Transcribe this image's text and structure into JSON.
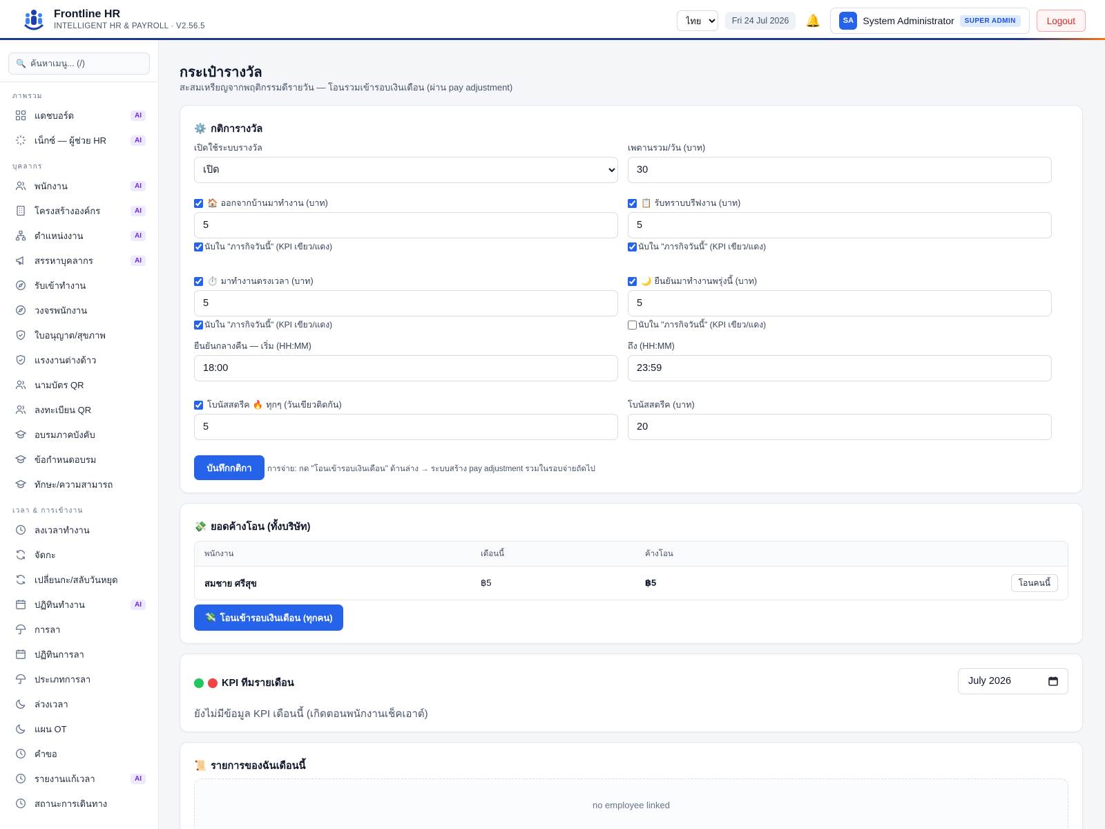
{
  "app": {
    "name": "Frontline HR",
    "subtitle": "INTELLIGENT HR & PAYROLL · V2.56.5"
  },
  "topbar": {
    "language": "ไทย",
    "date": "Fri 24 Jul 2026",
    "user_initials": "SA",
    "user_name": "System Administrator",
    "user_role": "SUPER ADMIN",
    "logout_label": "Logout"
  },
  "sidebar": {
    "search_placeholder": "ค้นหาเมนู... (/)",
    "sections": [
      {
        "title": "ภาพรวม",
        "items": [
          {
            "label": "แดชบอร์ด",
            "icon": "grid-icon",
            "ai": true
          },
          {
            "label": "เน็กซ์ — ผู้ช่วย HR",
            "icon": "sparkle-icon",
            "ai": true
          }
        ]
      },
      {
        "title": "บุคลากร",
        "items": [
          {
            "label": "พนักงาน",
            "icon": "users-icon",
            "ai": true
          },
          {
            "label": "โครงสร้างองค์กร",
            "icon": "building-icon",
            "ai": true
          },
          {
            "label": "ตำแหน่งงาน",
            "icon": "org-chart-icon",
            "ai": true
          },
          {
            "label": "สรรหาบุคลากร",
            "icon": "megaphone-icon",
            "ai": true
          },
          {
            "label": "รับเข้าทำงาน",
            "icon": "compass-icon",
            "ai": false
          },
          {
            "label": "วงจรพนักงาน",
            "icon": "compass-icon",
            "ai": false
          },
          {
            "label": "ใบอนุญาต/สุขภาพ",
            "icon": "shield-icon",
            "ai": false
          },
          {
            "label": "แรงงานต่างด้าว",
            "icon": "shield-icon",
            "ai": false
          },
          {
            "label": "นามบัตร QR",
            "icon": "users-icon",
            "ai": false
          },
          {
            "label": "ลงทะเบียน QR",
            "icon": "users-icon",
            "ai": false
          },
          {
            "label": "อบรมภาคบังคับ",
            "icon": "graduation-cap-icon",
            "ai": false
          },
          {
            "label": "ข้อกำหนดอบรม",
            "icon": "graduation-cap-icon",
            "ai": false
          },
          {
            "label": "ทักษะ/ความสามารถ",
            "icon": "graduation-cap-icon",
            "ai": false
          }
        ]
      },
      {
        "title": "เวลา & การเข้างาน",
        "items": [
          {
            "label": "ลงเวลาทำงาน",
            "icon": "clock-icon",
            "ai": false
          },
          {
            "label": "จัดกะ",
            "icon": "refresh-icon",
            "ai": false
          },
          {
            "label": "เปลี่ยนกะ/สลับวันหยุด",
            "icon": "refresh-icon",
            "ai": false
          },
          {
            "label": "ปฏิทินทำงาน",
            "icon": "calendar-icon",
            "ai": true
          },
          {
            "label": "การลา",
            "icon": "umbrella-icon",
            "ai": false
          },
          {
            "label": "ปฏิทินการลา",
            "icon": "calendar-icon",
            "ai": false
          },
          {
            "label": "ประเภทการลา",
            "icon": "umbrella-icon",
            "ai": false
          },
          {
            "label": "ล่วงเวลา",
            "icon": "moon-icon",
            "ai": false
          },
          {
            "label": "แผน OT",
            "icon": "moon-icon",
            "ai": false
          },
          {
            "label": "คำขอ",
            "icon": "clock-icon",
            "ai": false
          },
          {
            "label": "รายงานแก้เวลา",
            "icon": "clock-icon",
            "ai": true
          },
          {
            "label": "สถานะการเดินทาง",
            "icon": "clock-icon",
            "ai": false
          }
        ]
      }
    ],
    "ai_label": "AI"
  },
  "page": {
    "title": "กระเป๋ารางวัล",
    "subtitle": "สะสมเหรียญจากพฤติกรรมดีรายวัน — โอนรวมเข้ารอบเงินเดือน (ผ่าน pay adjustment)"
  },
  "rules": {
    "title": "กติการางวัล",
    "title_icon": "⚙️",
    "enable_label": "เปิดใช้ระบบรางวัล",
    "enable_value": "เปิด",
    "daily_cap_label": "เพดานรวม/วัน (บาท)",
    "daily_cap_value": "30",
    "count_label": "นับใน \"ภารกิจวันนี้\" (KPI เขียว/แดง)",
    "leave_home": {
      "icon": "🏠",
      "label": "ออกจากบ้านมาทำงาน (บาท)",
      "value": "5",
      "enabled": true,
      "count": true
    },
    "briefing": {
      "icon": "📋",
      "label": "รับทราบบรีฟงาน (บาท)",
      "value": "5",
      "enabled": true,
      "count": true
    },
    "on_time": {
      "icon": "⏱️",
      "label": "มาทำงานตรงเวลา (บาท)",
      "value": "5",
      "enabled": true,
      "count": true
    },
    "confirm_tomorrow": {
      "icon": "🌙",
      "label": "ยืนยันมาทำงานพรุ่งนี้ (บาท)",
      "value": "5",
      "enabled": true,
      "count": false
    },
    "night_start_label": "ยืนยันกลางคืน — เริ่ม (HH:MM)",
    "night_start_value": "18:00",
    "night_end_label": "ถึง (HH:MM)",
    "night_end_value": "23:59",
    "streak_every_label_a": "โบนัสสตรีค",
    "streak_every_icon": "🔥",
    "streak_every_label_b": "ทุกๆ (วันเขียวติดกัน)",
    "streak_every_value": "5",
    "streak_bonus_label": "โบนัสสตรีค (บาท)",
    "streak_bonus_value": "20",
    "save_label": "บันทึกกติกา",
    "save_hint": "การจ่าย: กด \"โอนเข้ารอบเงินเดือน\" ด้านล่าง → ระบบสร้าง pay adjustment รวมในรอบจ่ายถัดไป"
  },
  "pending": {
    "title": "ยอดค้างโอน (ทั้งบริษัท)",
    "title_icon": "💸",
    "columns": [
      "พนักงาน",
      "เดือนนี้",
      "ค้างโอน"
    ],
    "rows": [
      {
        "employee": "สมชาย ศรีสุข",
        "this_month": "฿5",
        "pending": "฿5",
        "action": "โอนคนนี้"
      }
    ],
    "transfer_all_icon": "💸",
    "transfer_all_label": "โอนเข้ารอบเงินเดือน (ทุกคน)"
  },
  "kpi": {
    "title": "KPI ทีมรายเดือน",
    "month": "July 2026",
    "empty": "ยังไม่มีข้อมูล KPI เดือนนี้ (เกิดตอนพนักงานเช็คเอาต์)",
    "green": "#22c55e",
    "red": "#ef4444"
  },
  "my_items": {
    "title": "รายการของฉันเดือนนี้",
    "title_icon": "📜",
    "empty": "no employee linked"
  },
  "colors": {
    "primary": "#2563eb",
    "brand_navy": "#1e3a8a",
    "accent_orange": "#f97316",
    "danger": "#dc2626"
  }
}
